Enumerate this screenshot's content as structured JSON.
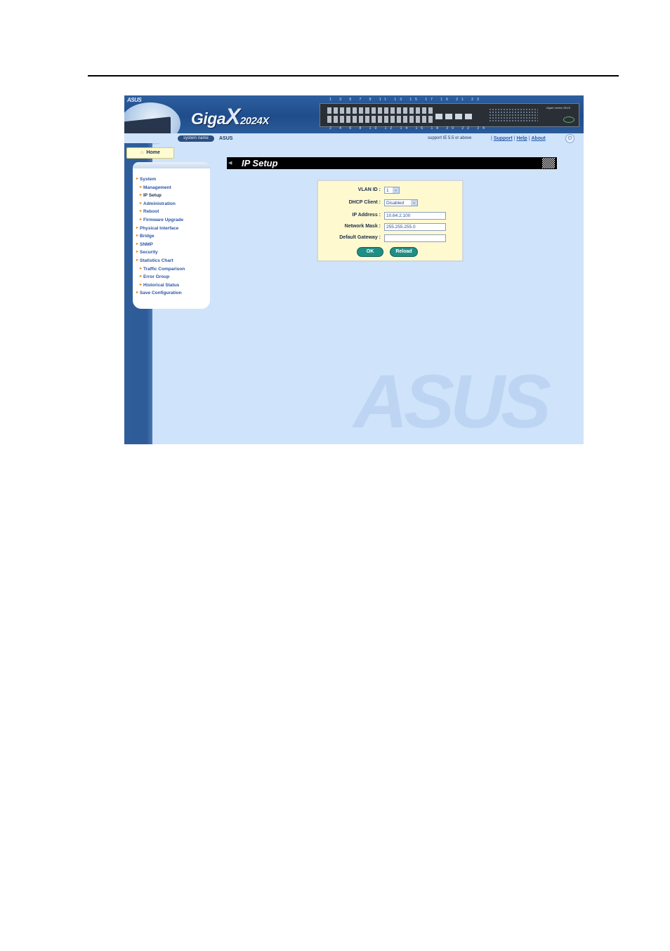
{
  "banner": {
    "logo_text": "ASUS",
    "brand_giga": "Giga",
    "brand_x": "X",
    "brand_model": "2024X",
    "port_numbers_top": "1 3 5 7 9 11 13 15 17 19 21 23",
    "port_numbers_bottom": "2 4 6 8 10 12 14 16 18 20 22 24",
    "panel_label": "GigaX series /ISUS"
  },
  "subbar": {
    "system_name_label": "system name",
    "system_name_value": "ASUS",
    "support_text": "support IE 5.5 or above",
    "links": [
      "Support",
      "Help",
      "About"
    ]
  },
  "sidebar": {
    "home_label": "Home",
    "items": [
      {
        "label": "System",
        "level": 1
      },
      {
        "label": "Management",
        "level": 2
      },
      {
        "label": "IP Setup",
        "level": 2,
        "active": true
      },
      {
        "label": "Administration",
        "level": 2
      },
      {
        "label": "Reboot",
        "level": 2
      },
      {
        "label": "Firmware Upgrade",
        "level": 2
      },
      {
        "label": "Physical Interface",
        "level": 1
      },
      {
        "label": "Bridge",
        "level": 1
      },
      {
        "label": "SNMP",
        "level": 1
      },
      {
        "label": "Security",
        "level": 1
      },
      {
        "label": "Statistics Chart",
        "level": 1
      },
      {
        "label": "Traffic Comparison",
        "level": 2
      },
      {
        "label": "Error Group",
        "level": 2
      },
      {
        "label": "Historical Status",
        "level": 2
      },
      {
        "label": "Save Configuration",
        "level": 1
      }
    ]
  },
  "page": {
    "title": "IP Setup"
  },
  "form": {
    "vlan_id_label": "VLAN ID :",
    "vlan_id_value": "1",
    "dhcp_label": "DHCP Client :",
    "dhcp_value": "Disabled",
    "ip_label": "IP Address :",
    "ip_value": "10.64.2.100",
    "mask_label": "Network Mask :",
    "mask_value": "255.255.255.0",
    "gateway_label": "Default Gateway :",
    "gateway_value": "",
    "ok_label": "OK",
    "reload_label": "Reload"
  },
  "watermark_text": "ASUS",
  "colors": {
    "content_bg": "#cfe3fb",
    "stripe": "#2e5d9a",
    "form_bg": "#fff9d0",
    "button": "#1f8f86",
    "menu_link": "#2c54a6",
    "bullet": "#f08a1c"
  }
}
